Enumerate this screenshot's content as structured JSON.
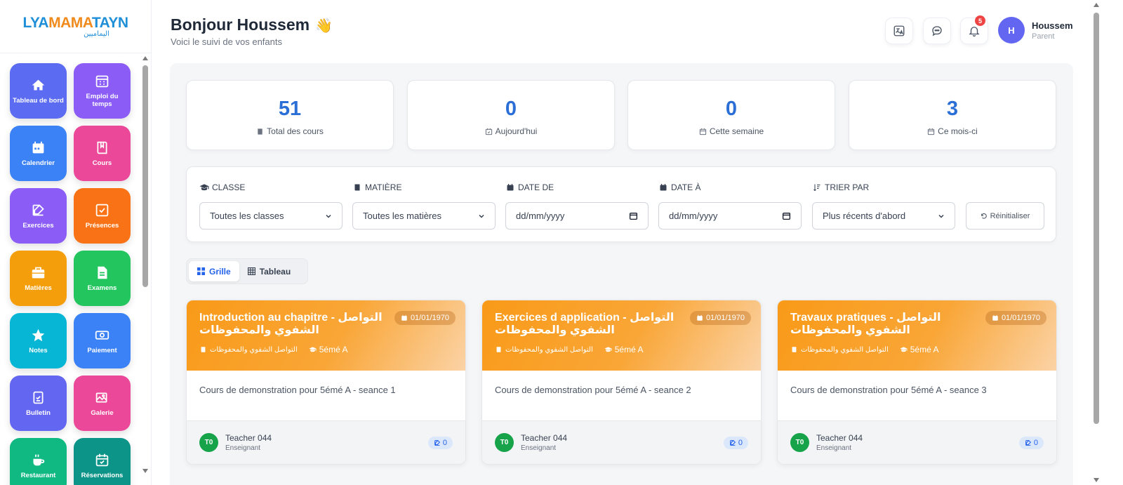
{
  "logo": {
    "text_main": "LYAMAMATAYN",
    "text_sub": "اليماميين"
  },
  "colors": {
    "accent": "#2b6fd6",
    "card_orange": "#f99a18",
    "avatar": "#6366f1",
    "badge": "#ef4444"
  },
  "sidebar": {
    "items": [
      {
        "label": "Tableau de bord",
        "icon": "home-icon",
        "color": "#5b6cf2"
      },
      {
        "label": "Emploi du temps",
        "icon": "calendar-grid-icon",
        "color": "#8b5cf6"
      },
      {
        "label": "Calendrier",
        "icon": "calendar-icon",
        "color": "#3b82f6"
      },
      {
        "label": "Cours",
        "icon": "book-icon",
        "color": "#ec4899"
      },
      {
        "label": "Exercices",
        "icon": "edit-icon",
        "color": "#8b5cf6"
      },
      {
        "label": "Présences",
        "icon": "checkbox-icon",
        "color": "#f97316"
      },
      {
        "label": "Matières",
        "icon": "briefcase-icon",
        "color": "#f59e0b"
      },
      {
        "label": "Examens",
        "icon": "document-icon",
        "color": "#22c55e"
      },
      {
        "label": "Notes",
        "icon": "star-icon",
        "color": "#06b6d4"
      },
      {
        "label": "Paiement",
        "icon": "money-icon",
        "color": "#3b82f6"
      },
      {
        "label": "Bulletin",
        "icon": "report-icon",
        "color": "#6366f1"
      },
      {
        "label": "Galerie",
        "icon": "gallery-icon",
        "color": "#ec4899"
      },
      {
        "label": "Restaurant",
        "icon": "coffee-icon",
        "color": "#10b981"
      },
      {
        "label": "Réservations",
        "icon": "calendar-check-icon",
        "color": "#0d9488"
      }
    ]
  },
  "header": {
    "greeting": "Bonjour Houssem",
    "wave": "👋",
    "subtitle": "Voici le suivi de vos enfants",
    "notif_count": "5",
    "user_initial": "H",
    "user_name": "Houssem",
    "user_role": "Parent"
  },
  "stats": [
    {
      "value": "51",
      "label": "Total des cours",
      "icon": "book-icon"
    },
    {
      "value": "0",
      "label": "Aujourd'hui",
      "icon": "calendar-check-icon"
    },
    {
      "value": "0",
      "label": "Cette semaine",
      "icon": "calendar-icon"
    },
    {
      "value": "3",
      "label": "Ce mois-ci",
      "icon": "calendar-icon"
    }
  ],
  "filters": {
    "classe_label": "CLASSE",
    "classe_value": "Toutes les classes",
    "matiere_label": "MATIÈRE",
    "matiere_value": "Toutes les matières",
    "date_de_label": "DATE DE",
    "date_de_placeholder": "dd/mm/yyyy",
    "date_a_label": "DATE À",
    "date_a_placeholder": "dd/mm/yyyy",
    "trier_label": "TRIER PAR",
    "trier_value": "Plus récents d'abord",
    "reset_label": "Réinitialiser"
  },
  "view_toggle": {
    "grid_label": "Grille",
    "table_label": "Tableau",
    "active": "grid"
  },
  "courses": [
    {
      "title": "Introduction au chapitre - التواصل الشفوي والمحفوظات",
      "date": "01/01/1970",
      "subject": "التواصل الشفوي والمحفوظات",
      "class": "5émé A",
      "description": "Cours de demonstration pour 5émé A - seance 1",
      "teacher_initials": "T0",
      "teacher_name": "Teacher 044",
      "teacher_role": "Enseignant",
      "exercises": "0"
    },
    {
      "title": "Exercices d application - التواصل الشفوي والمحفوظات",
      "date": "01/01/1970",
      "subject": "التواصل الشفوي والمحفوظات",
      "class": "5émé A",
      "description": "Cours de demonstration pour 5émé A - seance 2",
      "teacher_initials": "T0",
      "teacher_name": "Teacher 044",
      "teacher_role": "Enseignant",
      "exercises": "0"
    },
    {
      "title": "Travaux pratiques - التواصل الشفوي والمحفوظات",
      "date": "01/01/1970",
      "subject": "التواصل الشفوي والمحفوظات",
      "class": "5émé A",
      "description": "Cours de demonstration pour 5émé A - seance 3",
      "teacher_initials": "T0",
      "teacher_name": "Teacher 044",
      "teacher_role": "Enseignant",
      "exercises": "0"
    }
  ]
}
